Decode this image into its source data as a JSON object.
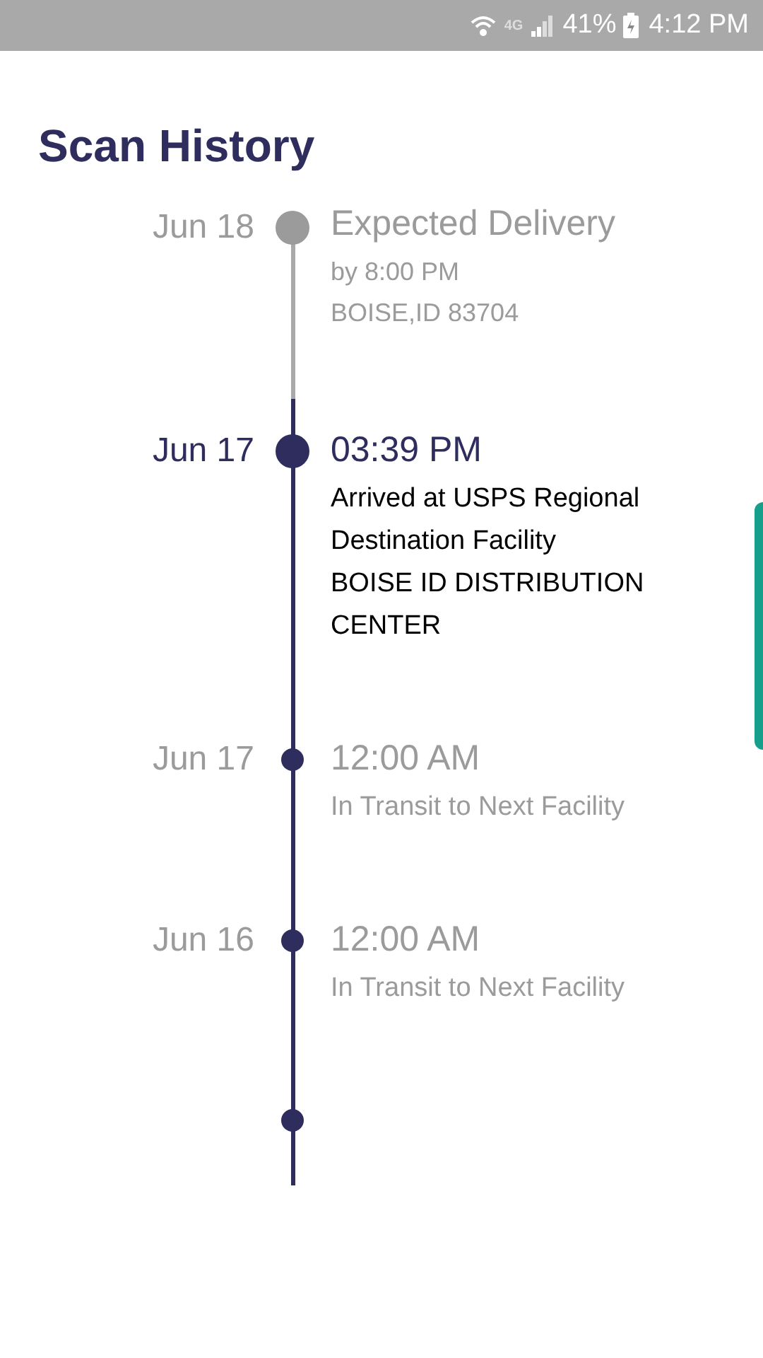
{
  "status_bar": {
    "network": "4G",
    "battery": "41%",
    "time": "4:12 PM"
  },
  "title": "Scan History",
  "events": [
    {
      "kind": "expected",
      "date": "Jun 18",
      "heading": "Expected Delivery",
      "lines": [
        "by 8:00 PM",
        "BOISE,ID 83704"
      ]
    },
    {
      "kind": "current",
      "date": "Jun 17",
      "heading": "03:39 PM",
      "lines": [
        "Arrived at USPS Regional Destination Facility",
        "BOISE ID DISTRIBUTION CENTER"
      ]
    },
    {
      "kind": "past",
      "date": "Jun 17",
      "heading": "12:00 AM",
      "lines": [
        "In Transit to Next Facility"
      ]
    },
    {
      "kind": "past",
      "date": "Jun 16",
      "heading": "12:00 AM",
      "lines": [
        "In Transit to Next Facility"
      ]
    }
  ]
}
